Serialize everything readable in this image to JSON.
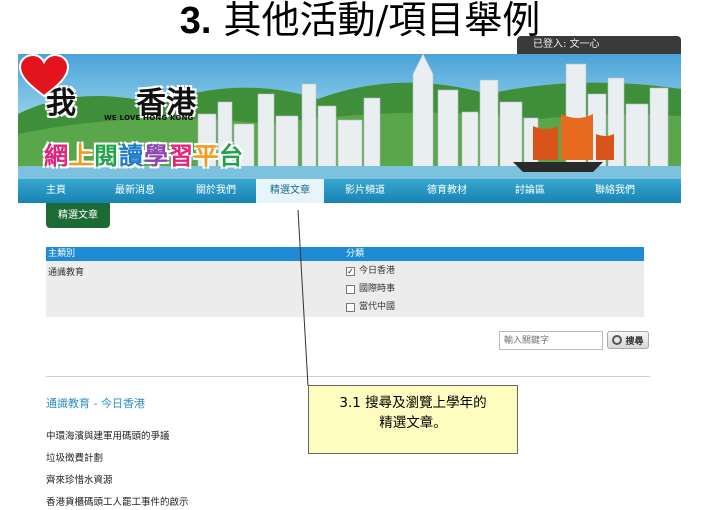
{
  "slide": {
    "title_num": "3.",
    "title_text": "其他活動/項目舉例"
  },
  "header": {
    "login_text": "已登入: 文一心",
    "logo": {
      "wo": "我",
      "hk": "香港",
      "sub": "WE LOVE HONG KONG",
      "learn": [
        "網",
        "上",
        "閱",
        "讀",
        "學",
        "習",
        "平",
        "台"
      ]
    }
  },
  "nav": {
    "items": [
      {
        "label": "主頁"
      },
      {
        "label": "最新消息"
      },
      {
        "label": "關於我們"
      },
      {
        "label": "精選文章"
      },
      {
        "label": "影片頻道"
      },
      {
        "label": "德育教材"
      },
      {
        "label": "討論區"
      },
      {
        "label": "聯絡我們"
      }
    ]
  },
  "tab": {
    "label": "精選文章"
  },
  "filter": {
    "col_main": "主類別",
    "col_sub": "分類",
    "main_value": "通識教育",
    "options": [
      {
        "label": "今日香港",
        "checked": true
      },
      {
        "label": "國際時事",
        "checked": false
      },
      {
        "label": "當代中國",
        "checked": false
      }
    ]
  },
  "search": {
    "placeholder": "輸入關鍵字",
    "button_label": "搜尋"
  },
  "results": {
    "section_title": "通識教育 - 今日香港",
    "articles": [
      "中環海濱與建軍用碼頭的爭議",
      "垃圾徵費計劃",
      "齊來珍惜水資源",
      "香港貨櫃碼頭工人罷工事件的啟示"
    ]
  },
  "callout": {
    "line1": "3.1 搜尋及瀏覽上學年的",
    "line2": "精選文章。"
  },
  "colors": {
    "nav": "#1683b3",
    "tab": "#1d6b34",
    "filter_head": "#1e8bd6",
    "callout_bg": "#fffcc0",
    "link": "#2b8fc7"
  }
}
